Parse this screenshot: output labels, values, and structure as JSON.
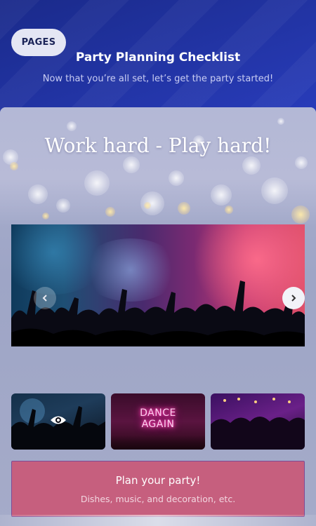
{
  "header": {
    "pages_label": "PAGES",
    "title": "Party Planning Checklist",
    "subtitle": "Now that you’re all set, let’s get the party started!"
  },
  "card": {
    "headline": "Work hard - Play hard!"
  },
  "carousel": {
    "prev_icon": "chevron-left-icon",
    "next_icon": "chevron-right-icon"
  },
  "thumbnails": [
    {
      "name": "concert-crowd",
      "icon": "eye-icon"
    },
    {
      "name": "neon-sign",
      "text_line1": "DANCE",
      "text_line2": "AGAIN"
    },
    {
      "name": "nightclub-crowd"
    }
  ],
  "cta": {
    "title": "Plan your party!",
    "subtitle": "Dishes, music, and decoration, etc."
  },
  "colors": {
    "accent": "#c65f7e",
    "header_bg": "#2a3ec0",
    "pill_bg": "#e4e6f4"
  }
}
